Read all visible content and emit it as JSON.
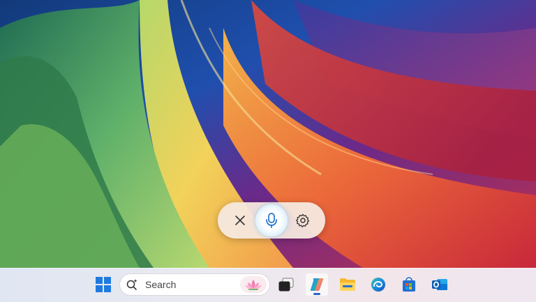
{
  "wallpaper": {
    "colors": [
      "#1f3d9e",
      "#2d7a4a",
      "#8fcf6a",
      "#f0c24a",
      "#e86a3a",
      "#c92f4a",
      "#8a2a78"
    ]
  },
  "voice_bar": {
    "close_icon": "close-icon",
    "mic_icon": "microphone-icon",
    "settings_icon": "gear-icon"
  },
  "taskbar": {
    "start_icon": "windows-start-icon",
    "search": {
      "placeholder": "Search",
      "icon": "search-sparkle-icon",
      "highlight_icon": "lotus-flower-icon"
    },
    "apps": [
      {
        "name": "task-view-icon"
      },
      {
        "name": "copilot-icon",
        "active": true
      },
      {
        "name": "file-explorer-icon"
      },
      {
        "name": "edge-icon"
      },
      {
        "name": "microsoft-store-icon"
      },
      {
        "name": "outlook-icon"
      }
    ]
  }
}
